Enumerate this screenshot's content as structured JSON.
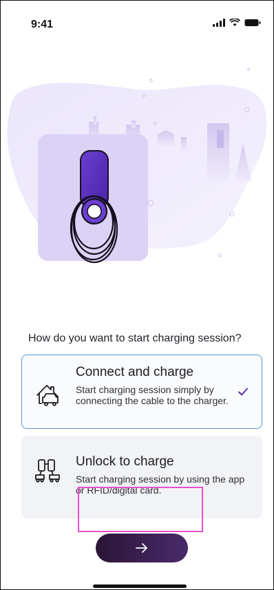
{
  "status_bar": {
    "time": "9:41"
  },
  "question": "How do you want to start charging session?",
  "options": [
    {
      "title": "Connect and charge",
      "description": "Start charging session simply by connecting the cable to the charger.",
      "selected": true,
      "icon": "car-home-icon"
    },
    {
      "title": "Unlock to charge",
      "description": "Start charging session by using the app or RFID/digital card.",
      "selected": false,
      "icon": "chargers-icon"
    }
  ],
  "next_button": {
    "icon": "arrow-right-icon"
  },
  "colors": {
    "primary": "#5a2fbf",
    "selected_border": "#5b8fd1",
    "highlight": "#e64fd3"
  }
}
